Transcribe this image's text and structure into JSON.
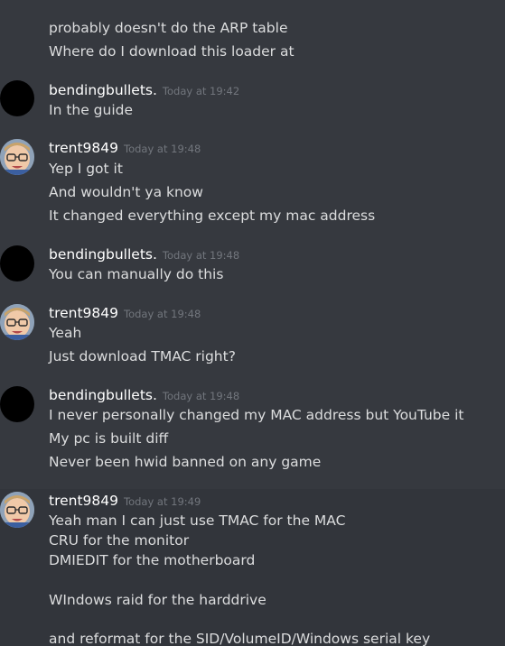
{
  "messages": {
    "top_line_1": "probably doesn't do the ARP table",
    "top_line_2": "Where do I download this loader at",
    "m1": {
      "user": "bendingbullets.",
      "time": "Today at 19:42",
      "lines": [
        "In the guide"
      ]
    },
    "m2": {
      "user": "trent9849",
      "time": "Today at 19:48",
      "lines": [
        "Yep I got it",
        "And wouldn't ya know",
        "It changed everything except my mac address"
      ]
    },
    "m3": {
      "user": "bendingbullets.",
      "time": "Today at 19:48",
      "lines": [
        "You can manually do this"
      ]
    },
    "m4": {
      "user": "trent9849",
      "time": "Today at 19:48",
      "lines": [
        "Yeah",
        "Just download TMAC right?"
      ]
    },
    "m5": {
      "user": "bendingbullets.",
      "time": "Today at 19:48",
      "lines": [
        "I never personally changed my MAC address but YouTube it",
        "My pc is built diff",
        "Never been hwid banned on any game"
      ]
    },
    "m6": {
      "user": "trent9849",
      "time": "Today at 19:49",
      "lines": [
        "Yeah man I can just use TMAC for the MAC",
        "CRU for the monitor",
        "DMIEDIT for the motherboard",
        "WIndows raid for the harddrive",
        "and reformat for the SID/VolumeID/Windows serial key"
      ]
    }
  },
  "icons": {
    "dark_avatar": "black-circle-avatar",
    "kid_avatar": "child-photo-avatar"
  }
}
